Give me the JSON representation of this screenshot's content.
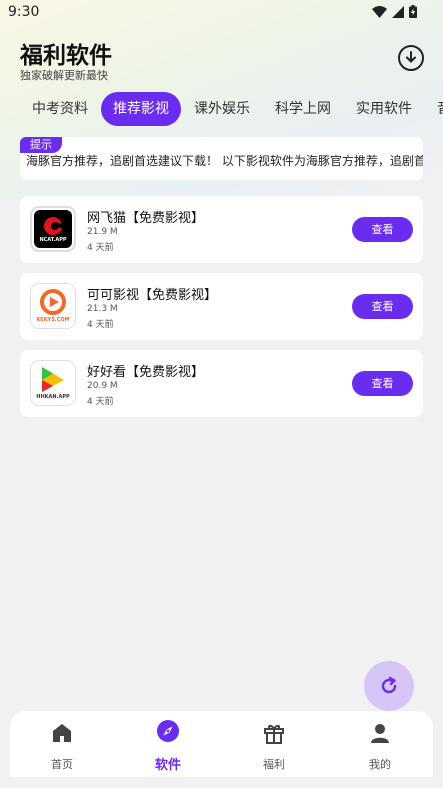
{
  "status_bar": {
    "time": "9:30"
  },
  "header": {
    "title": "福利软件",
    "subtitle": "独家破解更新最快",
    "download_icon": "download-icon"
  },
  "tabs": [
    {
      "label": "中考资料",
      "active": false
    },
    {
      "label": "推荐影视",
      "active": true
    },
    {
      "label": "课外娱乐",
      "active": false
    },
    {
      "label": "科学上网",
      "active": false
    },
    {
      "label": "实用软件",
      "active": false
    },
    {
      "label": "音乐",
      "active": false
    }
  ],
  "notice": {
    "badge": "提示",
    "text": "海豚官方推荐，追剧首选建议下载！    以下影视软件为海豚官方推荐，追剧首选建议下载！"
  },
  "apps": [
    {
      "name": "网飞猫【免费影视】",
      "size": "21.9 M",
      "date": "4 天前",
      "button": "查看",
      "icon_text": "NCAT.APP",
      "icon_color": "#e2141e"
    },
    {
      "name": "可可影视【免费影视】",
      "size": "21.3 M",
      "date": "4 天前",
      "button": "查看",
      "icon_text": "KEKYS.COM",
      "icon_color": "#f26a2a"
    },
    {
      "name": "好好看【免费影视】",
      "size": "20.9 M",
      "date": "4 天前",
      "button": "查看",
      "icon_text": "HHKAN.APP",
      "icon_color": "#f5c000"
    }
  ],
  "bottom_nav": [
    {
      "label": "首页",
      "icon": "home-icon",
      "active": false
    },
    {
      "label": "软件",
      "icon": "compass-icon",
      "active": true
    },
    {
      "label": "福利",
      "icon": "gift-icon",
      "active": false
    },
    {
      "label": "我的",
      "icon": "user-icon",
      "active": false
    }
  ],
  "colors": {
    "accent": "#6a2df0",
    "refresh_bg": "#d6c6f8"
  }
}
